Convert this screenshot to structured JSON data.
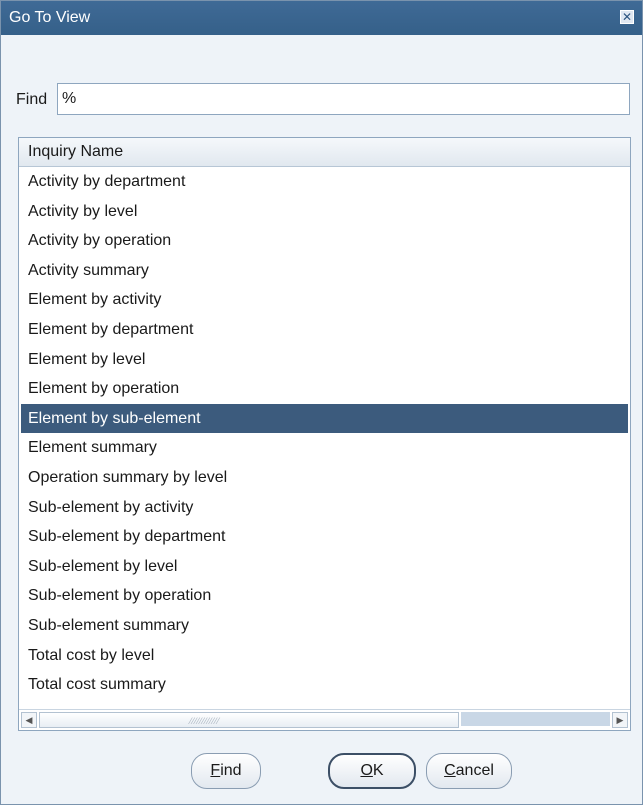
{
  "window": {
    "title": "Go To View",
    "close_glyph": "✕"
  },
  "find": {
    "label": "Find",
    "value": "%"
  },
  "list": {
    "column_header": "Inquiry Name",
    "items": [
      "Activity by department",
      "Activity by level",
      "Activity by operation",
      "Activity summary",
      "Element by activity",
      "Element by department",
      "Element by level",
      "Element by operation",
      "Element by sub-element",
      "Element summary",
      "Operation summary by level",
      "Sub-element by activity",
      "Sub-element by department",
      "Sub-element by level",
      "Sub-element by operation",
      "Sub-element summary",
      "Total cost by level",
      "Total cost summary"
    ],
    "selected_index": 8
  },
  "scrollbar": {
    "left_arrow": "◀",
    "right_arrow": "▶",
    "grip": "⁄⁄⁄⁄⁄⁄⁄⁄⁄⁄⁄⁄"
  },
  "buttons": {
    "find": {
      "mnemonic": "F",
      "rest": "ind"
    },
    "ok": {
      "mnemonic": "O",
      "rest": "K"
    },
    "cancel": {
      "mnemonic": "C",
      "rest": "ancel"
    }
  },
  "colors": {
    "titlebar": "#3f6a96",
    "selection": "#3c5b7d",
    "dialog_bg": "#eef3f8"
  }
}
